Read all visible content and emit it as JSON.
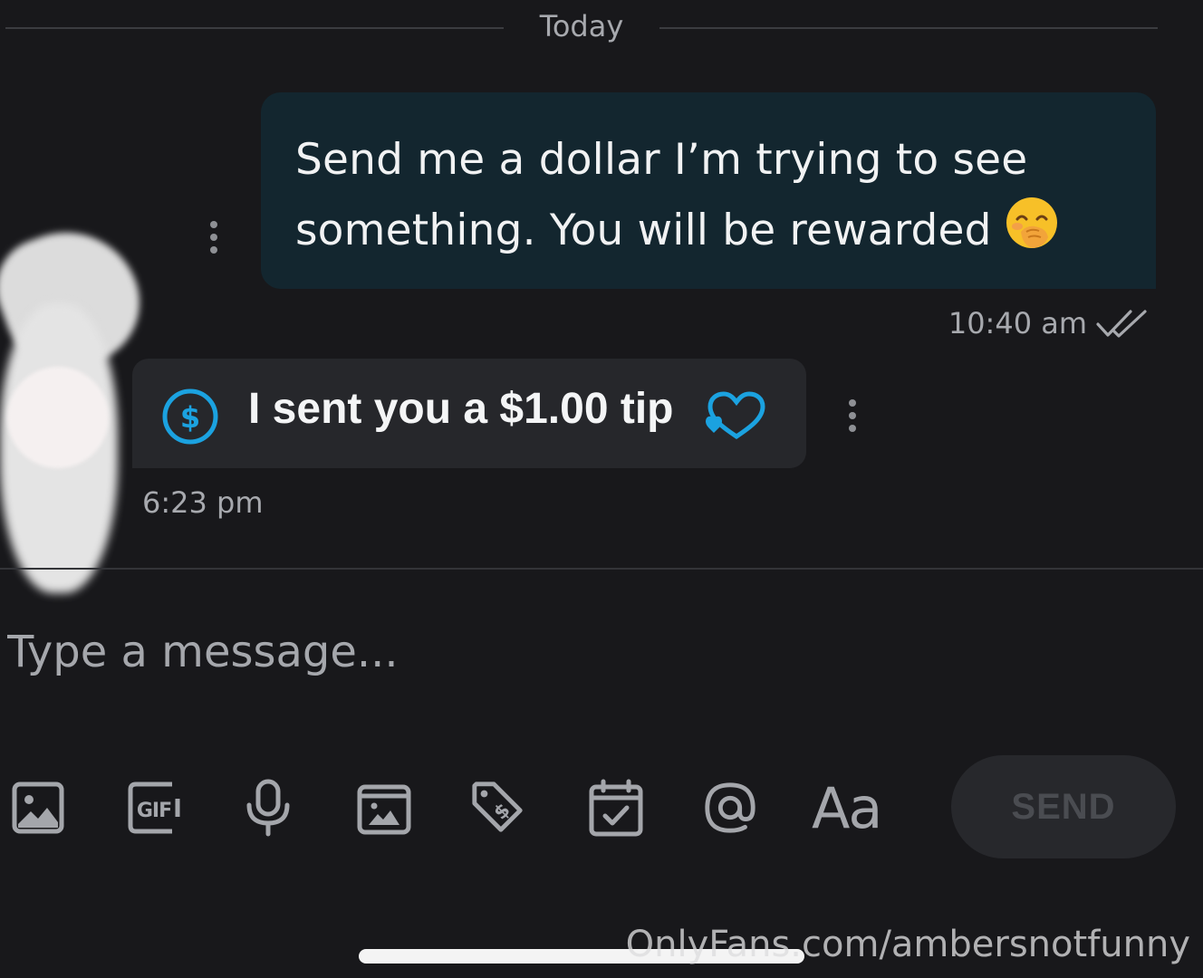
{
  "divider": {
    "label": "Today"
  },
  "outgoing": {
    "text": "Send me a dollar I’m trying to see something. You will be rewarded",
    "emoji": "hand-over-mouth-emoji",
    "time": "10:40 am",
    "status_icon": "double-check-icon"
  },
  "incoming": {
    "text": "I sent you a $1.00 tip",
    "time": "6:23 pm",
    "icon": "dollar-circle-icon",
    "heart_icon": "heart-icon"
  },
  "composer": {
    "placeholder": "Type a message...",
    "tools": [
      "image-icon",
      "gif-icon",
      "microphone-icon",
      "vault-media-icon",
      "price-tag-icon",
      "schedule-icon",
      "mention-icon",
      "text-format-icon"
    ],
    "format_label": "Aa",
    "send_label": "SEND"
  },
  "watermark": "OnlyFans.com/ambersnotfunny",
  "colors": {
    "background": "#18181b",
    "outgoing_bubble": "#13262f",
    "incoming_bubble": "#26272b",
    "accent": "#1ba2e0",
    "muted_text": "#a7a9ae"
  }
}
